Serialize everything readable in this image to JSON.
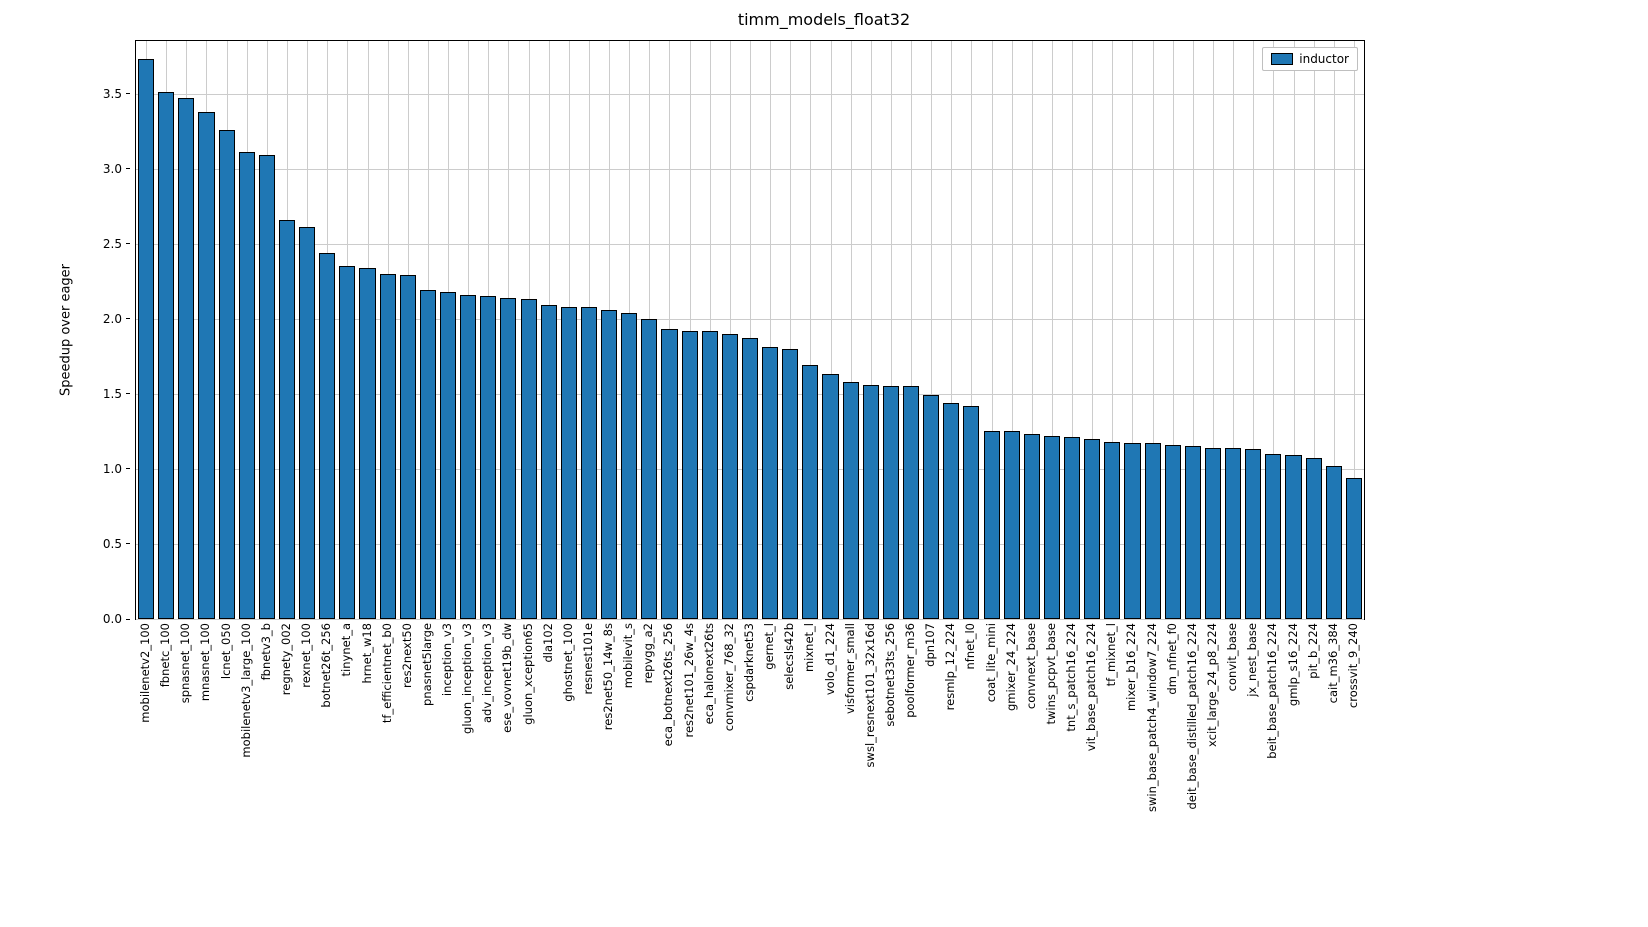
{
  "chart_data": {
    "type": "bar",
    "title": "timm_models_float32",
    "xlabel": "",
    "ylabel": "Speedup over eager",
    "ylim": [
      0,
      3.85
    ],
    "yticks": [
      0.0,
      0.5,
      1.0,
      1.5,
      2.0,
      2.5,
      3.0,
      3.5
    ],
    "legend": [
      "inductor"
    ],
    "categories": [
      "mobilenetv2_100",
      "fbnetc_100",
      "spnasnet_100",
      "mnasnet_100",
      "lcnet_050",
      "mobilenetv3_large_100",
      "fbnetv3_b",
      "regnety_002",
      "rexnet_100",
      "botnet26t_256",
      "tinynet_a",
      "hrnet_w18",
      "tf_efficientnet_b0",
      "res2next50",
      "pnasnet5large",
      "inception_v3",
      "gluon_inception_v3",
      "adv_inception_v3",
      "ese_vovnet19b_dw",
      "gluon_xception65",
      "dla102",
      "ghostnet_100",
      "resnest101e",
      "res2net50_14w_8s",
      "mobilevit_s",
      "repvgg_a2",
      "eca_botnext26ts_256",
      "res2net101_26w_4s",
      "eca_halonext26ts",
      "convmixer_768_32",
      "cspdarknet53",
      "gernet_l",
      "selecsls42b",
      "mixnet_l",
      "volo_d1_224",
      "visformer_small",
      "swsl_resnext101_32x16d",
      "sebotnet33ts_256",
      "poolformer_m36",
      "dpn107",
      "resmlp_12_224",
      "nfnet_l0",
      "coat_lite_mini",
      "gmixer_24_224",
      "convnext_base",
      "twins_pcpvt_base",
      "tnt_s_patch16_224",
      "vit_base_patch16_224",
      "tf_mixnet_l",
      "mixer_b16_224",
      "swin_base_patch4_window7_224",
      "dm_nfnet_f0",
      "deit_base_distilled_patch16_224",
      "xcit_large_24_p8_224",
      "convit_base",
      "jx_nest_base",
      "beit_base_patch16_224",
      "gmlp_s16_224",
      "pit_b_224",
      "cait_m36_384",
      "crossvit_9_240"
    ],
    "values": [
      3.73,
      3.51,
      3.47,
      3.38,
      3.26,
      3.11,
      3.09,
      2.66,
      2.61,
      2.44,
      2.35,
      2.34,
      2.3,
      2.29,
      2.19,
      2.18,
      2.16,
      2.15,
      2.14,
      2.13,
      2.09,
      2.08,
      2.08,
      2.06,
      2.04,
      2.0,
      1.93,
      1.92,
      1.92,
      1.9,
      1.87,
      1.81,
      1.8,
      1.69,
      1.63,
      1.58,
      1.56,
      1.55,
      1.55,
      1.49,
      1.44,
      1.42,
      1.25,
      1.25,
      1.23,
      1.22,
      1.21,
      1.2,
      1.18,
      1.17,
      1.17,
      1.16,
      1.15,
      1.14,
      1.14,
      1.13,
      1.1,
      1.09,
      1.07,
      1.02,
      0.94
    ]
  }
}
